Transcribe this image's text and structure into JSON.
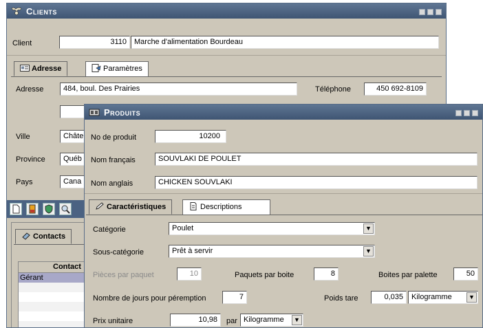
{
  "clients": {
    "title": "Clients",
    "client_label": "Client",
    "client_number": "3110",
    "client_name": "Marche d'alimentation Bourdeau",
    "tabs": [
      {
        "label": "Adresse"
      },
      {
        "label": "Paramètres"
      }
    ],
    "address_label": "Adresse",
    "address_value": "484, boul. Des Prairies",
    "phone_label": "Téléphone",
    "phone_value": "450 692-8109",
    "city_label": "Ville",
    "city_value": "Châte",
    "province_label": "Province",
    "province_value": "Québ",
    "country_label": "Pays",
    "country_value": "Cana",
    "contacts_tab": "Contacts",
    "contact_header": "Contact",
    "contact_rows": [
      "Gérant"
    ]
  },
  "produits": {
    "title": "Produits",
    "product_no_label": "No de produit",
    "product_no_value": "10200",
    "name_fr_label": "Nom français",
    "name_fr_value": "SOUVLAKI DE POULET",
    "name_en_label": "Nom anglais",
    "name_en_value": "CHICKEN SOUVLAKI",
    "tabs": [
      {
        "label": "Caractéristiques"
      },
      {
        "label": "Descriptions"
      }
    ],
    "category_label": "Catégorie",
    "category_value": "Poulet",
    "subcategory_label": "Sous-catégorie",
    "subcategory_value": "Prêt à servir",
    "pieces_label": "Pièces par paquet",
    "pieces_value": "10",
    "packs_label": "Paquets par boite",
    "packs_value": "8",
    "boxes_label": "Boites par palette",
    "boxes_value": "50",
    "expiry_label": "Nombre de jours pour péremption",
    "expiry_value": "7",
    "tare_label": "Poids tare",
    "tare_value": "0,035",
    "tare_unit": "Kilogramme",
    "price_label": "Prix unitaire",
    "price_value": "10,98",
    "per_label": "par",
    "price_unit": "Kilogramme"
  },
  "colors": {
    "titlebar": "#4b6282",
    "window_bg": "#cdc7b9",
    "toolbar_bg": "#4b6282"
  }
}
